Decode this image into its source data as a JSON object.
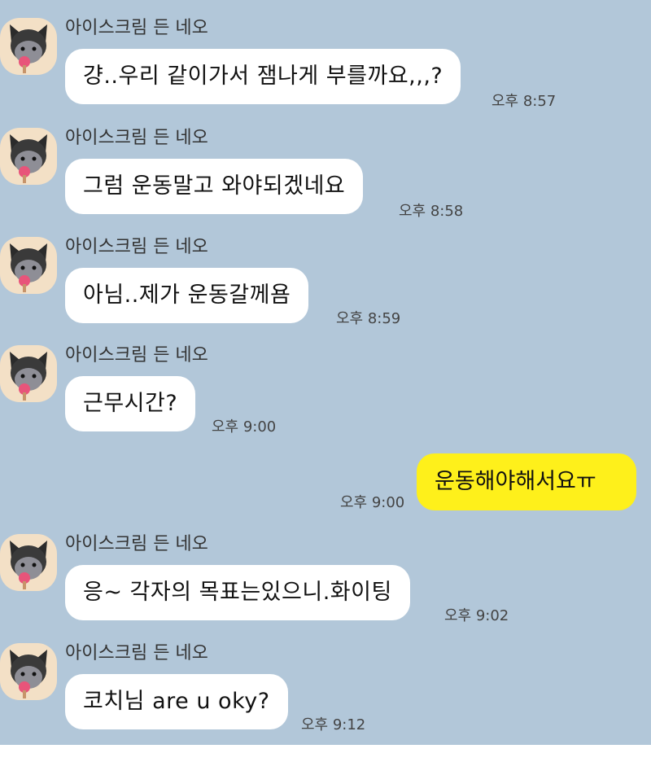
{
  "sender_name": "아이스크림 든 네오",
  "messages": [
    {
      "type": "in",
      "text": "걍..우리 같이가서 잼나게 부를까요,,,?",
      "time": "오후 8:57"
    },
    {
      "type": "in",
      "text": "그럼 운동말고 와야되겠네요",
      "time": "오후 8:58"
    },
    {
      "type": "in",
      "text": "아님..제가 운동갈께욤",
      "time": "오후 8:59"
    },
    {
      "type": "in",
      "text": "근무시간?",
      "time": "오후 9:00"
    },
    {
      "type": "out",
      "text": "운동해야해서요ㅠ",
      "time": "오후 9:00"
    },
    {
      "type": "in",
      "text": "응~ 각자의 목표는있으니.화이팅",
      "time": "오후 9:02"
    },
    {
      "type": "in",
      "text": "코치님 are u oky?",
      "time": "오후 9:12"
    }
  ],
  "colors": {
    "background": "#b2c7d9",
    "incoming_bubble": "#ffffff",
    "outgoing_bubble": "#fef01b",
    "avatar_bg": "#f3e0c6"
  },
  "avatar_icon": "neo-character-icon"
}
